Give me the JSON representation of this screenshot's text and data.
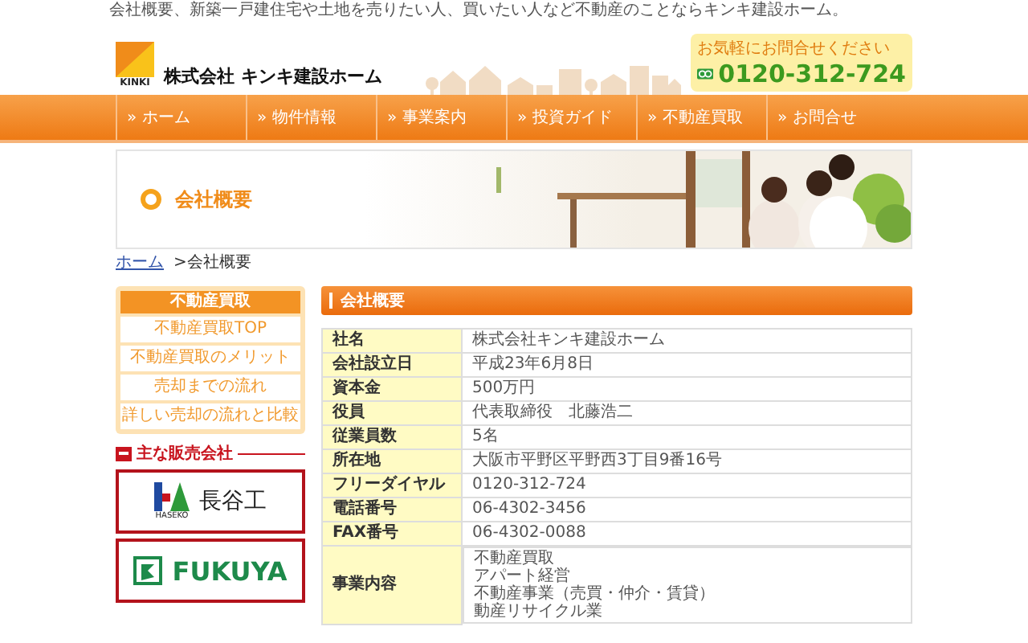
{
  "tagline": "会社概要、新築一戸建住宅や土地を売りたい人、買いたい人など不動産のことならキンキ建設ホーム。",
  "logo": {
    "mark": "KINKI",
    "name": "株式会社 キンキ建設ホーム"
  },
  "contact": {
    "prompt": "お気軽にお問合せください",
    "phone": "0120-312-724"
  },
  "nav": [
    {
      "label": "ホーム",
      "marker": "»"
    },
    {
      "label": "物件情報",
      "marker": "»"
    },
    {
      "label": "事業案内",
      "marker": "»"
    },
    {
      "label": "投資ガイド",
      "marker": "»"
    },
    {
      "label": "不動産買取",
      "marker": "»"
    },
    {
      "label": "お問合せ",
      "marker": "»"
    }
  ],
  "banner": {
    "title": "会社概要"
  },
  "breadcrumb": {
    "link": "ホーム",
    "current": ">会社概要"
  },
  "sidebar": {
    "menu_title": "不動産買取",
    "items": [
      "不動産買取TOP",
      "不動産買取のメリット",
      "売却までの流れ",
      "詳しい売却の流れと比較"
    ],
    "partners_title": "主な販売会社",
    "partners": [
      {
        "name": "長谷工",
        "sub": "HASEKO"
      },
      {
        "name": "FUKUYA"
      }
    ]
  },
  "section": {
    "title": "会社概要",
    "rows": [
      {
        "label": "社名",
        "value": "株式会社キンキ建設ホーム"
      },
      {
        "label": "会社設立日",
        "value": "平成23年6月8日"
      },
      {
        "label": "資本金",
        "value": "500万円"
      },
      {
        "label": "役員",
        "value": "代表取締役　北藤浩二"
      },
      {
        "label": "従業員数",
        "value": "5名"
      },
      {
        "label": "所在地",
        "value": "大阪市平野区平野西3丁目9番16号"
      },
      {
        "label": "フリーダイヤル",
        "value": "0120-312-724"
      },
      {
        "label": "電話番号",
        "value": "06-4302-3456"
      },
      {
        "label": "FAX番号",
        "value": "06-4302-0088"
      },
      {
        "label": "事業内容",
        "lines": [
          "不動産買取",
          "アパート経営",
          "不動産事業（売買・仲介・賃貸）",
          "動産リサイクル業"
        ]
      }
    ]
  }
}
